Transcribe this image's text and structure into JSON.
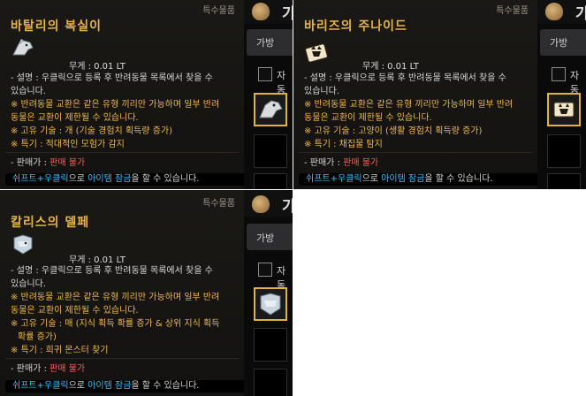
{
  "common": {
    "category": "특수물품",
    "weight_label": "무게 : ",
    "weight_value": "0.01 LT",
    "desc_line1": "- 설명 : 우클릭으로 등록 후 반려동물 목록에서 찾을 수",
    "desc_line2": "있습니다.",
    "exchange_line1": "※ 반려동물 교환은 같은 유형 끼리만 가능하며 일부 반려",
    "exchange_line2": "동물은 교환이 제한될 수 있습니다.",
    "seller_label": "- 판매가 : ",
    "seller_value": "판매 불가",
    "footer_shift": "쉬프트+우클릭",
    "footer_mid": "으로 ",
    "footer_lock": "아이템 잠금",
    "footer_end": "을 할 수 있습니다.",
    "side_letter": "가",
    "side_tab": "가방",
    "side_check": "자동"
  },
  "items": [
    {
      "title": "바탈리의 복실이",
      "skill_line1": "※ 고유 기술 : 개 (기술 경험치 획득량 증가)",
      "skill_line2": "",
      "special": "※ 특기 : 적대적인 모험가 감지"
    },
    {
      "title": "바리즈의 주나이드",
      "skill_line1": "※ 고유 기술 : 고양이 (생활 경험치 획득량 증가)",
      "skill_line2": "",
      "special": "※ 특기 : 채집물 탐지"
    },
    {
      "title": "칼리스의 델페",
      "skill_line1": "※ 고유 기술 : 매 (지식 획득 확률 증가 & 상위 지식 획득",
      "skill_line2": "확률 증가)",
      "special": "※ 특기 : 희귀 몬스터 찾기"
    }
  ],
  "colors": {
    "title_gold": "#e8b43f",
    "highlight_orange": "#f0b84a",
    "seller_red": "#ff5a5a",
    "footer_cyan": "#35c7ff",
    "slot_selected": "#e2b436"
  }
}
